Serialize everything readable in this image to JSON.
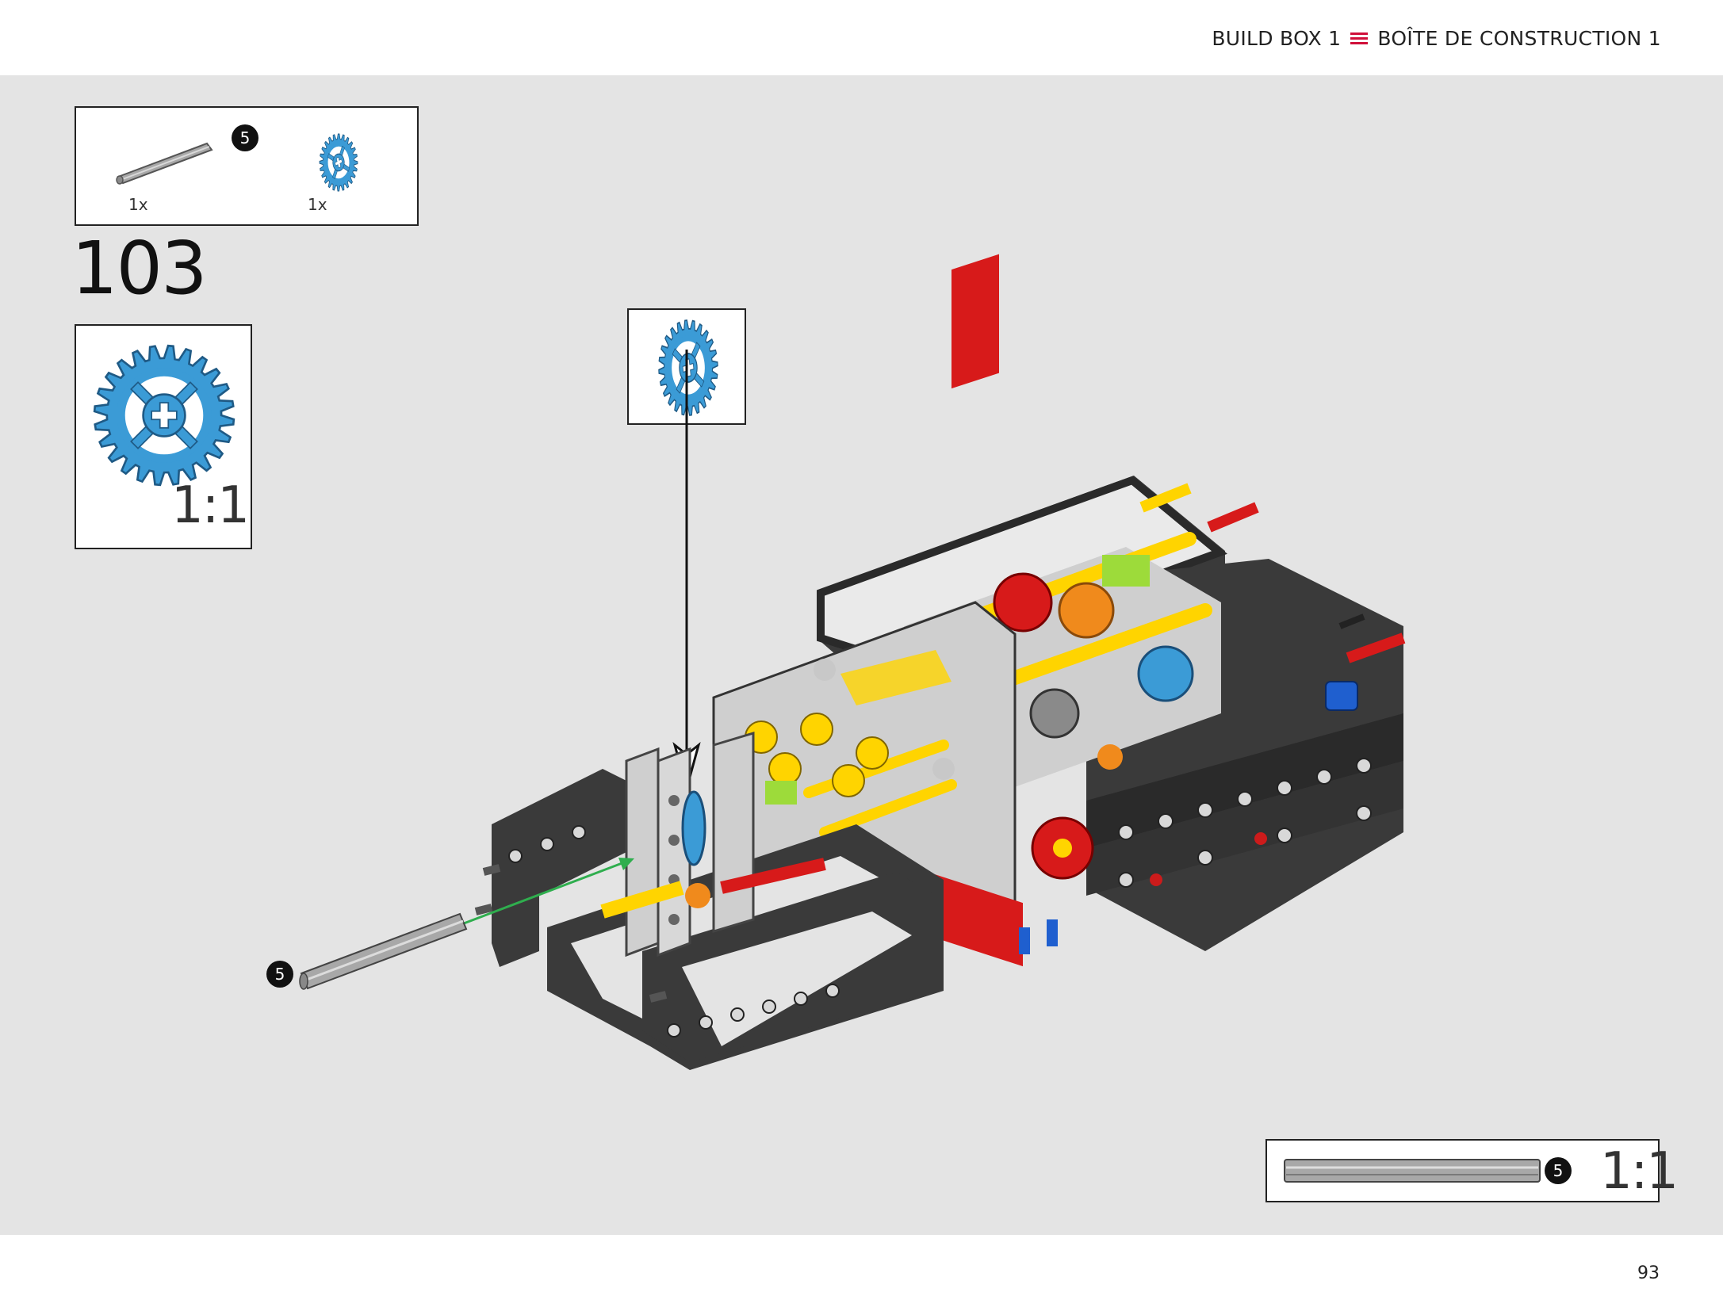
{
  "header": {
    "left_label": "BUILD BOX 1",
    "separator_icon": "triple-line-icon",
    "right_label": "BOÎTE DE CONSTRUCTION 1",
    "accent_color": "#d0103a"
  },
  "parts_list": {
    "items": [
      {
        "icon": "axle-icon",
        "badge": "5",
        "quantity": "1x",
        "color": "#9a9a9a"
      },
      {
        "icon": "gear-icon",
        "quantity": "1x",
        "color": "#3b9bd6"
      }
    ]
  },
  "step": {
    "number": "103"
  },
  "gear_scale": {
    "icon": "gear-icon",
    "label": "1:1",
    "color": "#3b9bd6"
  },
  "callout": {
    "icon": "gear-icon"
  },
  "assembly": {
    "axle_badge": "5",
    "arrow_color": "#2fae4e"
  },
  "ruler": {
    "badge": "5",
    "label": "1:1"
  },
  "footer": {
    "page_number": "93"
  }
}
